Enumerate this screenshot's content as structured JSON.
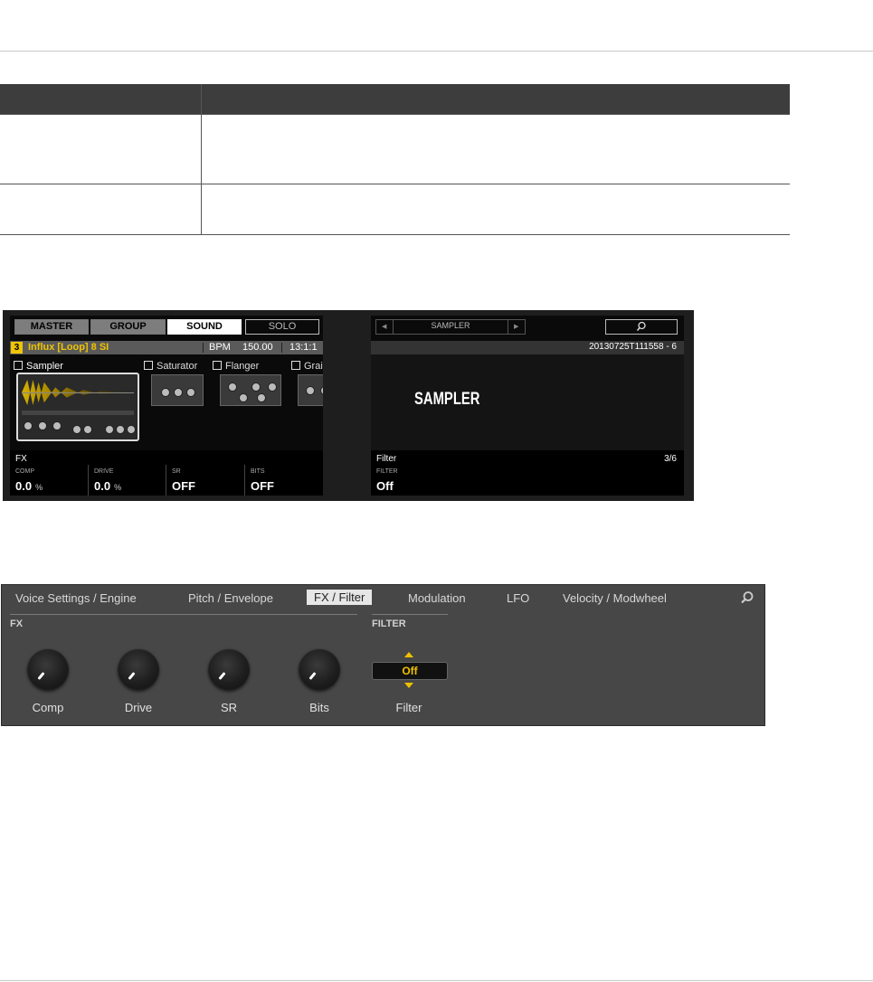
{
  "hardware_screens": {
    "left": {
      "tabs": [
        "MASTER",
        "GROUP",
        "SOUND",
        "SOLO"
      ],
      "active_tab": "SOUND",
      "slot_number": "3",
      "sound_name": "Influx [Loop] 8 SI",
      "bpm_label": "BPM",
      "bpm_value": "150.00",
      "position": "13:1:1",
      "plugins": [
        "Sampler",
        "Saturator",
        "Flanger",
        "Grai"
      ],
      "fx_title": "FX",
      "params": [
        {
          "label": "COMP",
          "value": "0.0",
          "unit": "%"
        },
        {
          "label": "DRIVE",
          "value": "0.0",
          "unit": "%"
        },
        {
          "label": "SR",
          "value": "OFF",
          "unit": ""
        },
        {
          "label": "BITS",
          "value": "OFF",
          "unit": ""
        }
      ]
    },
    "right": {
      "nav_label": "SAMPLER",
      "date_label": "20130725T111558 - 6",
      "big_title": "SAMPLER",
      "page_title": "Filter",
      "page_count": "3/6",
      "param_label": "FILTER",
      "param_value": "Off"
    }
  },
  "plugin_panel": {
    "tabs": [
      "Voice Settings / Engine",
      "Pitch / Envelope",
      "FX / Filter",
      "Modulation",
      "LFO",
      "Velocity / Modwheel"
    ],
    "active_tab": "FX / Filter",
    "fx_section_label": "FX",
    "filter_section_label": "FILTER",
    "knobs": [
      "Comp",
      "Drive",
      "SR",
      "Bits"
    ],
    "filter_value": "Off",
    "filter_label": "Filter",
    "accent_color": "#f0c000"
  }
}
